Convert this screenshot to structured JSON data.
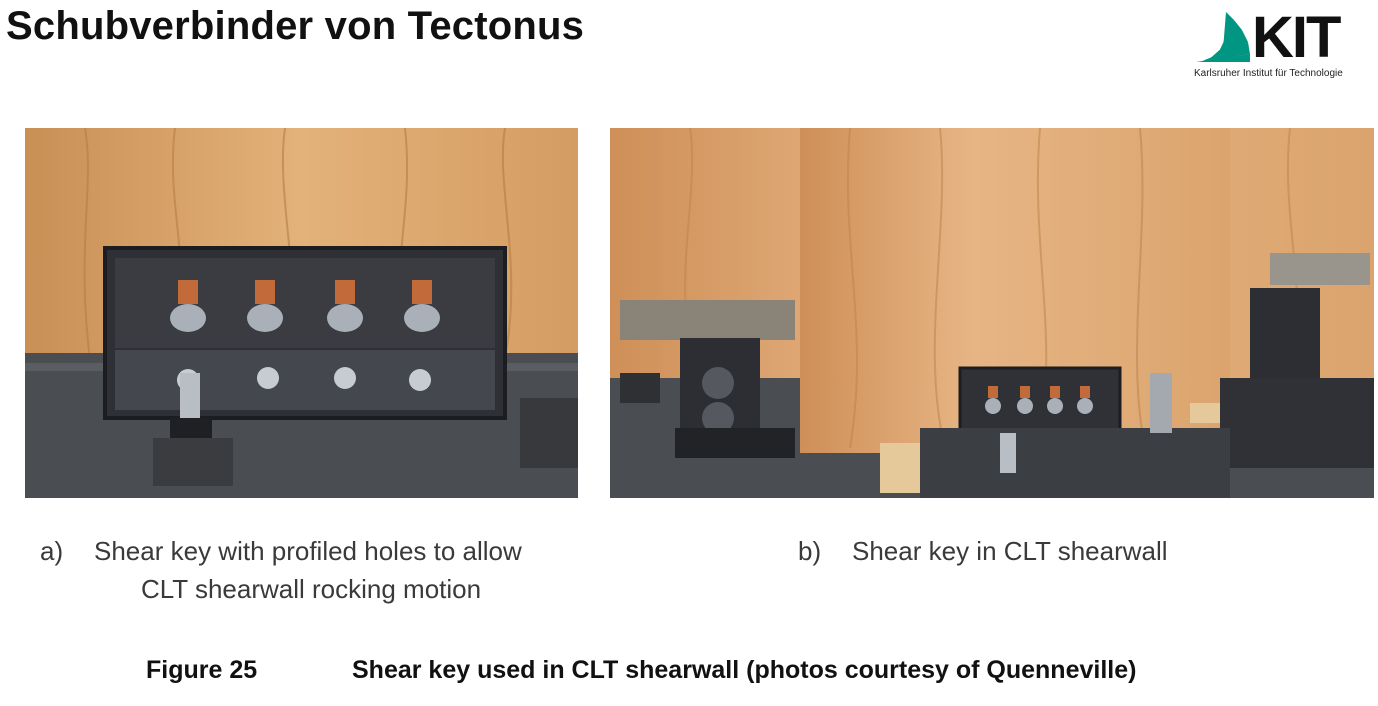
{
  "slide": {
    "title": "Schubverbinder von Tectonus"
  },
  "logo": {
    "name": "KIT",
    "subtitle": "Karlsruher Institut für Technologie",
    "brand_color": "#009682"
  },
  "figures": [
    {
      "marker": "a)",
      "caption_line1": "Shear key with profiled holes to allow",
      "caption_line2": "CLT shearwall rocking motion"
    },
    {
      "marker": "b)",
      "caption_line1": "Shear key in CLT shearwall"
    }
  ],
  "figure_caption": {
    "label": "Figure 25",
    "text": "Shear key used in CLT shearwall (photos courtesy of Quenneville)"
  },
  "colors": {
    "wood": "#d9a46b",
    "steel": "#3c3f44",
    "floor": "#4a4d52"
  }
}
